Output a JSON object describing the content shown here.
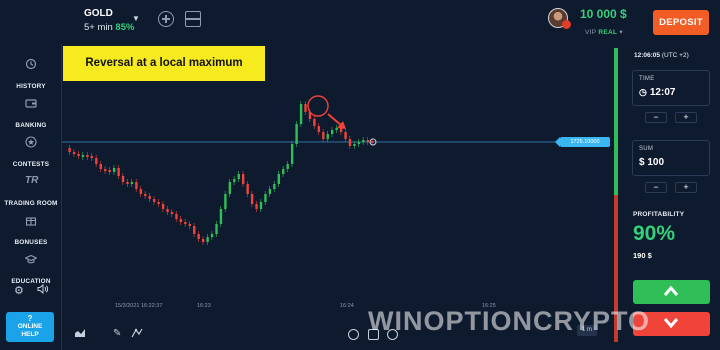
{
  "asset": {
    "name": "GOLD",
    "duration": "5+ min",
    "payout": "85%"
  },
  "account": {
    "balance": "10 000 $",
    "status_prefix": "VIP",
    "status": "REAL",
    "deposit_label": "DEPOSIT"
  },
  "sidebar": {
    "items": [
      {
        "label": "HISTORY",
        "icon": "history-icon"
      },
      {
        "label": "BANKING",
        "icon": "wallet-icon"
      },
      {
        "label": "CONTESTS",
        "icon": "star-icon"
      },
      {
        "label": "TRADING ROOM",
        "icon": "tr-logo-icon"
      },
      {
        "label": "BONUSES",
        "icon": "gift-icon"
      },
      {
        "label": "EDUCATION",
        "icon": "graduation-cap-icon"
      }
    ],
    "help_label_1": "?",
    "help_label_2": "ONLINE",
    "help_label_3": "HELP"
  },
  "chart": {
    "banner": "Reversal at a local maximum",
    "datestamp": "15/3/2021 16:22:37",
    "time_labels": [
      "16:23",
      "16:24",
      "16:25"
    ],
    "price_tag": "1725.10000",
    "timeframe": "1 m"
  },
  "panel": {
    "clock": "12:06:05",
    "timezone": "(UTC +2)",
    "time_label": "TIME",
    "time_value": "12:07",
    "sum_label": "SUM",
    "sum_value": "$ 100",
    "profitability_label": "PROFITABILITY",
    "profitability_pct": "90%",
    "profit_amount": "190 $"
  },
  "watermark": "WINOPTIONCRYPTO",
  "colors": {
    "bg": "#0e1a2e",
    "green": "#2fbf56",
    "red": "#f0433a",
    "accent": "#f25c25",
    "banner": "#f7ea1f"
  }
}
